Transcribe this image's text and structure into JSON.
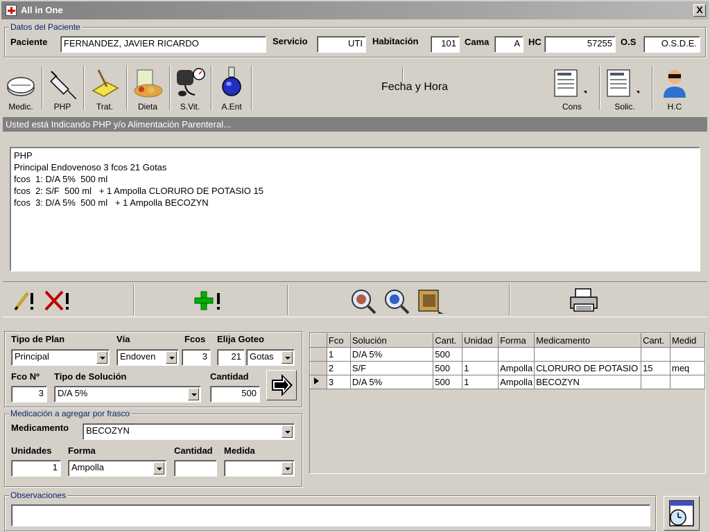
{
  "window": {
    "title": "All in One",
    "close_label": "X"
  },
  "patient_group": {
    "legend": "Datos del Paciente",
    "paciente_label": "Paciente",
    "paciente_value": "FERNANDEZ, JAVIER RICARDO",
    "servicio_label": "Servicio",
    "servicio_value": "UTI",
    "habitacion_label": "Habitación",
    "habitacion_value": "101",
    "cama_label": "Cama",
    "cama_value": "A",
    "hc_label": "HC",
    "hc_value": "57255",
    "os_label": "O.S",
    "os_value": "O.S.D.E."
  },
  "toolbar": {
    "buttons": [
      {
        "label": "Medic.",
        "icon": "pill-icon"
      },
      {
        "label": "PHP",
        "icon": "syringe-icon"
      },
      {
        "label": "Trat.",
        "icon": "treatment-icon"
      },
      {
        "label": "Dieta",
        "icon": "food-icon"
      },
      {
        "label": "S.Vit.",
        "icon": "blood-pressure-icon"
      },
      {
        "label": "A.Ent",
        "icon": "flask-icon"
      }
    ],
    "center_label": "Fecha y Hora",
    "right_buttons": [
      {
        "label": "Cons",
        "icon": "document-icon"
      },
      {
        "label": "Solic.",
        "icon": "document-icon"
      },
      {
        "label": "H.C",
        "icon": "doctor-icon"
      }
    ]
  },
  "status_message": "Usted está Indicando PHP y/o Alimentación Parenteral...",
  "memo_lines": [
    "PHP",
    "Principal Endovenoso 3 fcos 21 Gotas",
    "fcos  1: D/A 5%  500 ml",
    "fcos  2: S/F  500 ml   + 1 Ampolla CLORURO DE POTASIO 15",
    "fcos  3: D/A 5%  500 ml   + 1 Ampolla BECOZYN"
  ],
  "plan_form": {
    "tipo_plan_label": "Tipo de Plan",
    "tipo_plan_value": "Principal",
    "via_label": "Vía",
    "via_value": "Endoven",
    "fcos_label": "Fcos",
    "fcos_value": "3",
    "goteo_label": "Elija Goteo",
    "goteo_value": "21",
    "goteo_unit": "Gotas",
    "fco_no_label": "Fco Nº",
    "fco_no_value": "3",
    "tipo_solucion_label": "Tipo de Solución",
    "tipo_solucion_value": "D/A 5%",
    "cantidad_label": "Cantidad",
    "cantidad_value": "500"
  },
  "medicacion_group": {
    "legend": "Medicación a agregar por frasco",
    "medicamento_label": "Medicamento",
    "medicamento_value": "BECOZYN",
    "unidades_label": "Unidades",
    "unidades_value": "1",
    "forma_label": "Forma",
    "forma_value": "Ampolla",
    "cantidad_label": "Cantidad",
    "cantidad_value": "",
    "medida_label": "Medida",
    "medida_value": ""
  },
  "grid": {
    "headers": [
      "Fco",
      "Solución",
      "Cant.",
      "Unidad",
      "Forma",
      "Medicamento",
      "Cant.",
      "Medid"
    ],
    "rows": [
      [
        "1",
        "D/A 5%",
        "500",
        "",
        "",
        "",
        "",
        ""
      ],
      [
        "2",
        "S/F",
        "500",
        "1",
        "Ampolla",
        "CLORURO DE POTASIO",
        "15",
        "meq"
      ],
      [
        "3",
        "D/A 5%",
        "500",
        "1",
        "Ampolla",
        "BECOZYN",
        "",
        ""
      ]
    ],
    "selected_row": 2
  },
  "observaciones": {
    "legend": "Observaciones",
    "value": ""
  }
}
